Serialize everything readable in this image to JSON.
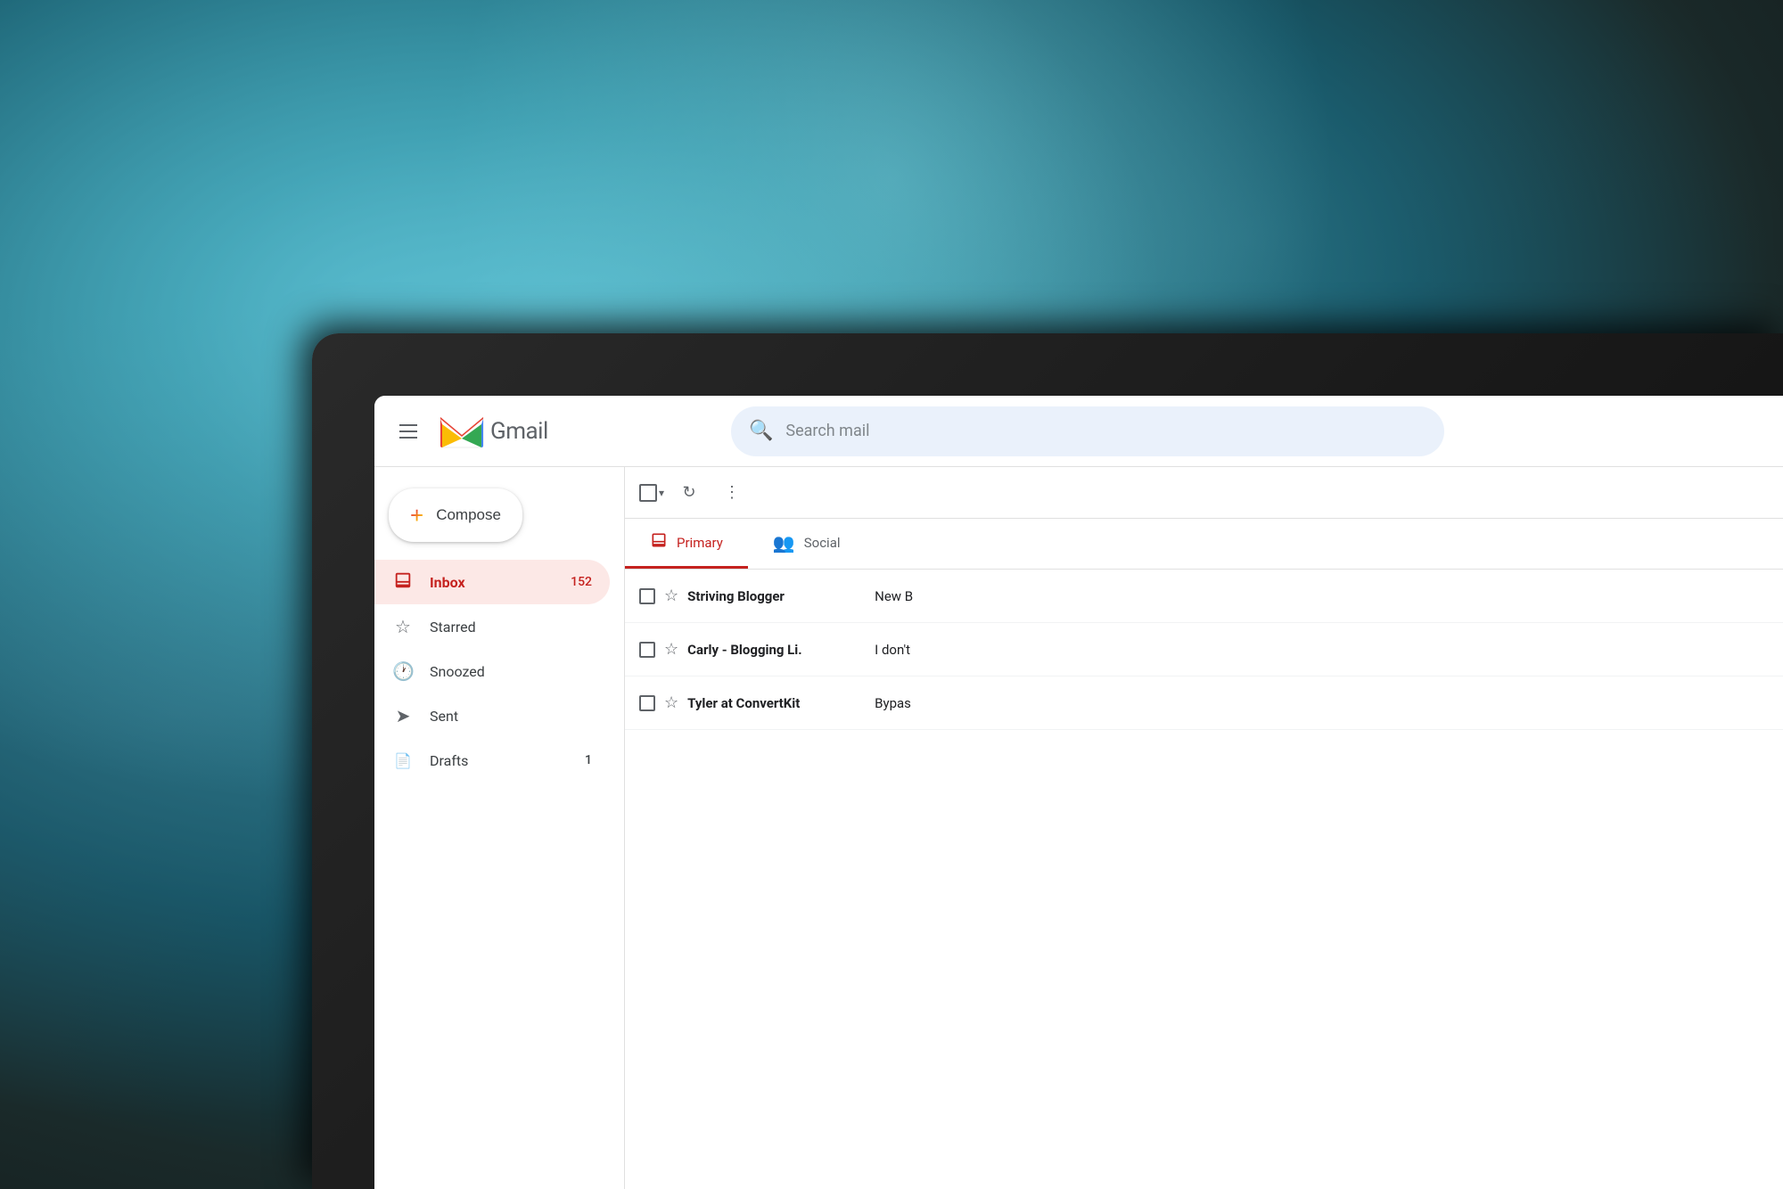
{
  "background": {
    "color_main": "#1a6677",
    "color_accent": "#5bbccc"
  },
  "gmail": {
    "header": {
      "menu_icon_label": "Main menu",
      "logo_text": "Gmail",
      "search_placeholder": "Search mail"
    },
    "sidebar": {
      "compose_label": "Compose",
      "nav_items": [
        {
          "id": "inbox",
          "label": "Inbox",
          "badge": "152",
          "active": true,
          "icon": "inbox"
        },
        {
          "id": "starred",
          "label": "Starred",
          "badge": "",
          "active": false,
          "icon": "star"
        },
        {
          "id": "snoozed",
          "label": "Snoozed",
          "badge": "",
          "active": false,
          "icon": "clock"
        },
        {
          "id": "sent",
          "label": "Sent",
          "badge": "",
          "active": false,
          "icon": "send"
        },
        {
          "id": "drafts",
          "label": "Drafts",
          "badge": "1",
          "active": false,
          "icon": "drafts"
        }
      ]
    },
    "toolbar": {
      "select_all_label": "Select all",
      "refresh_label": "Refresh",
      "more_label": "More"
    },
    "tabs": [
      {
        "id": "primary",
        "label": "Primary",
        "icon": "inbox",
        "active": true
      },
      {
        "id": "social",
        "label": "Social",
        "icon": "people",
        "active": false
      }
    ],
    "emails": [
      {
        "id": 1,
        "sender": "Striving Blogger",
        "preview": "New B",
        "unread": true
      },
      {
        "id": 2,
        "sender": "Carly - Blogging Li.",
        "preview": "I don't",
        "unread": true
      },
      {
        "id": 3,
        "sender": "Tyler at ConvertKit",
        "preview": "Bypas",
        "unread": true
      }
    ]
  }
}
